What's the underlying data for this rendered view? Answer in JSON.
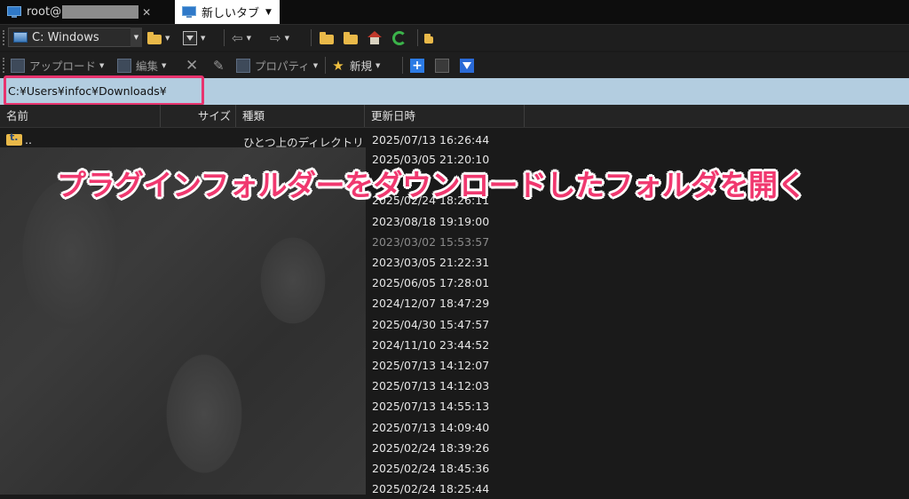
{
  "tabs": [
    {
      "label": "root@",
      "icon": "monitor-icon",
      "close": "✕"
    },
    {
      "label": "新しいタブ",
      "icon": "monitor-icon"
    }
  ],
  "toolbar1": {
    "drive": "C: Windows"
  },
  "toolbar2": {
    "upload": "アップロード",
    "edit": "編集",
    "properties": "プロパティ",
    "new": "新規"
  },
  "address": "C:¥Users¥infoc¥Downloads¥",
  "columns": {
    "name": "名前",
    "size": "サイズ",
    "type": "種類",
    "modified": "更新日時"
  },
  "parent_row": {
    "name": "..",
    "type": "ひとつ上のディレクトリ",
    "date": "2025/07/13 16:26:44"
  },
  "dates": [
    "2025/03/05 21:20:10",
    "",
    "2025/02/24 18:26:11",
    "2023/08/18 19:19:00",
    "2023/03/02 15:53:57",
    "2023/03/05 21:22:31",
    "2025/06/05 17:28:01",
    "2024/12/07 18:47:29",
    "2025/04/30 15:47:57",
    "2024/11/10 23:44:52",
    "2025/07/13 14:12:07",
    "2025/07/13 14:12:03",
    "2025/07/13 14:55:13",
    "2025/07/13 14:09:40",
    "2025/02/24 18:39:26",
    "2025/02/24 18:45:36",
    "2025/02/24 18:25:44"
  ],
  "annotation": "プラグインフォルダーをダウンロードしたフォルダを開く",
  "colors": {
    "annotation": "#f0386f",
    "highlight_box": "#e8336e",
    "address_bar": "#b3cde0"
  }
}
